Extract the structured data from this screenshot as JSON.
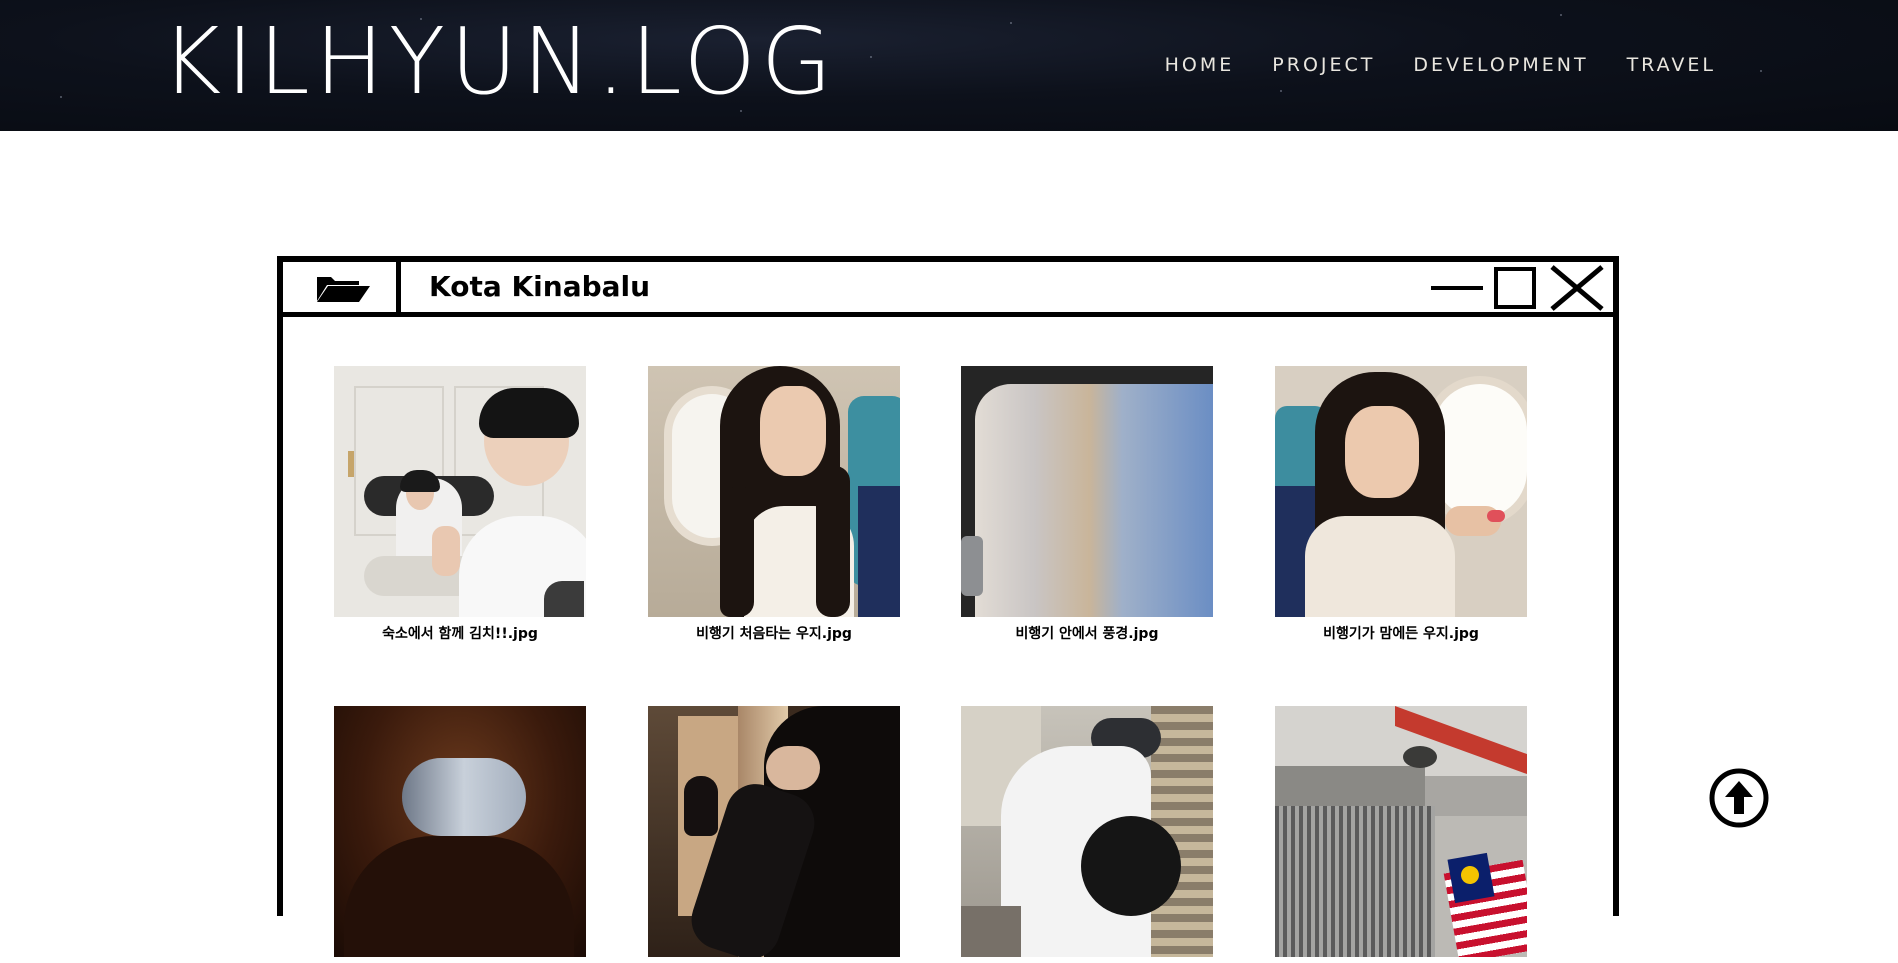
{
  "site": {
    "logo": "KILHYUN.LOG",
    "nav": [
      "HOME",
      "PROJECT",
      "DEVELOPMENT",
      "TRAVEL"
    ]
  },
  "window": {
    "title": "Kota Kinabalu",
    "folder_icon": "open-folder-icon",
    "controls": [
      "minimize-icon",
      "maximize-icon",
      "close-icon"
    ]
  },
  "gallery": {
    "items": [
      {
        "caption": "숙소에서 함께 김치!!.jpg"
      },
      {
        "caption": "비행기 처음타는 우지.jpg"
      },
      {
        "caption": "비행기 안에서 풍경.jpg"
      },
      {
        "caption": "비행기가 맘에든 우지.jpg"
      },
      {
        "caption": ""
      },
      {
        "caption": ""
      },
      {
        "caption": ""
      },
      {
        "caption": ""
      }
    ]
  },
  "scroll_top": {
    "icon": "arrow-up-circle-icon"
  },
  "colors": {
    "header_bg": "#0b0f18",
    "nav_text": "#e9e6df",
    "window_border": "#000000"
  }
}
